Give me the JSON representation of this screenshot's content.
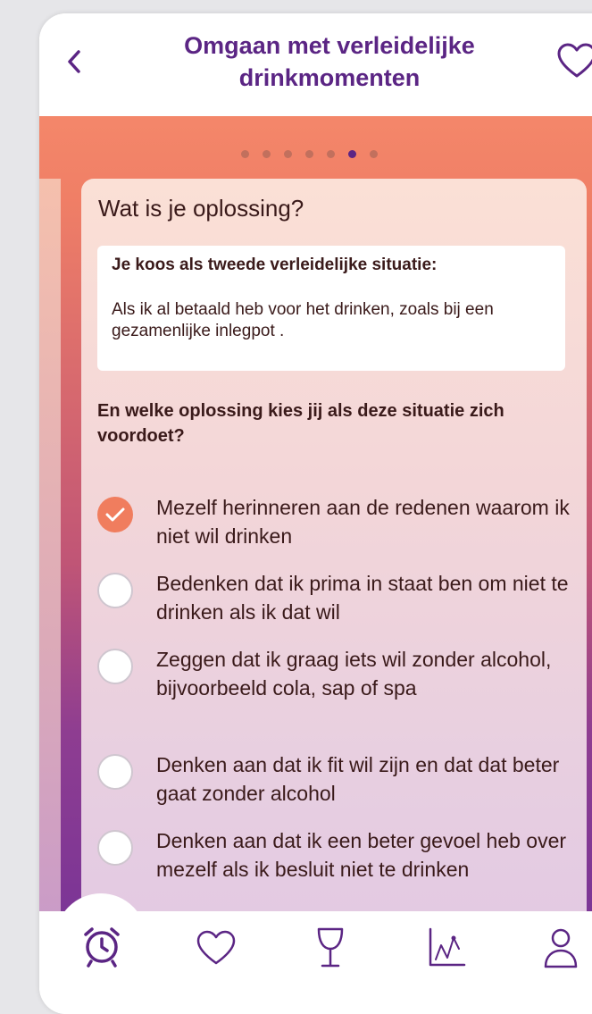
{
  "header": {
    "back_icon": "chevron-left-icon",
    "title": "Omgaan met verleidelijke drinkmomenten",
    "favorite_icon": "heart-outline-icon"
  },
  "pager": {
    "total": 7,
    "active_index": 5
  },
  "card": {
    "question": "Wat is je oplossing?",
    "note": {
      "label": "Je koos als tweede verleidelijke situatie:",
      "text": "Als ik al betaald heb voor het drinken, zoals bij een gezamenlijke inlegpot ."
    },
    "prompt": "En welke oplossing kies jij als deze situatie zich voordoet?",
    "options": [
      {
        "label": "Mezelf herinneren aan de redenen waarom ik niet wil drinken",
        "selected": true
      },
      {
        "label": "Bedenken dat ik prima in staat ben om niet te drinken als ik dat wil",
        "selected": false
      },
      {
        "label": "Zeggen dat ik graag iets wil zonder alcohol, bijvoorbeeld cola, sap of spa",
        "selected": false
      },
      {
        "label": "Denken aan dat ik fit wil zijn en dat dat beter gaat zonder alcohol",
        "selected": false
      },
      {
        "label": "Denken aan dat ik een beter gevoel heb over mezelf als ik besluit niet te drinken",
        "selected": false
      }
    ]
  },
  "bottom_nav": {
    "items": [
      {
        "icon": "alarm-clock-icon",
        "active": true
      },
      {
        "icon": "heart-outline-icon",
        "active": false
      },
      {
        "icon": "wine-glass-icon",
        "active": false
      },
      {
        "icon": "line-chart-icon",
        "active": false
      },
      {
        "icon": "user-profile-icon",
        "active": false
      }
    ]
  },
  "colors": {
    "brand_purple": "#5b2584",
    "accent_orange": "#f07d5e",
    "text_dark": "#3a1a1a"
  }
}
